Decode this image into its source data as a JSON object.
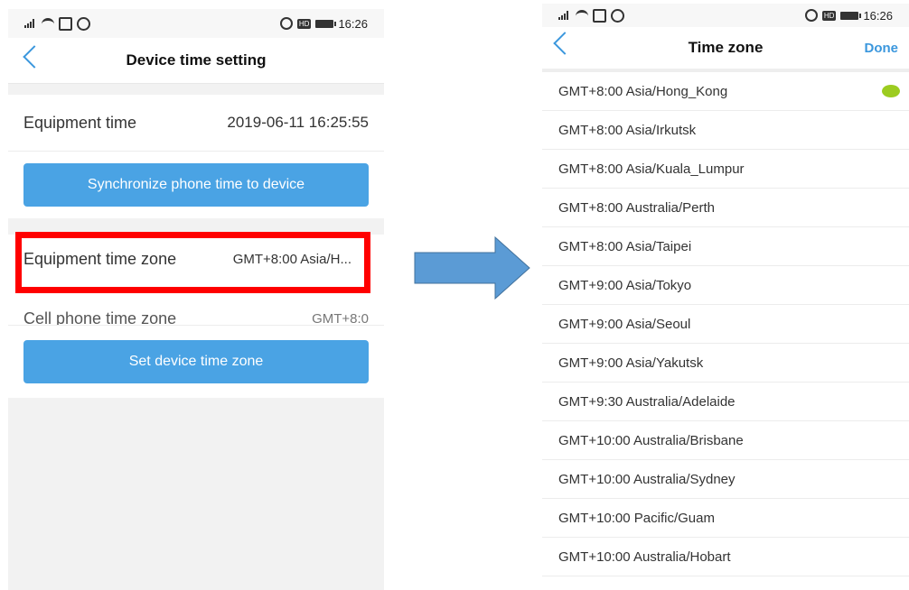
{
  "status": {
    "time": "16:26",
    "network": "4G",
    "hd": "HD"
  },
  "left": {
    "title": "Device time setting",
    "equipment_time_label": "Equipment time",
    "equipment_time_value": "2019-06-11 16:25:55",
    "sync_button": "Synchronize phone time to device",
    "equipment_zone_label": "Equipment time zone",
    "equipment_zone_value": "GMT+8:00 Asia/H...",
    "cell_zone_label": "Cell phone time zone",
    "cell_zone_value": "GMT+8:0",
    "set_button": "Set device time zone"
  },
  "right": {
    "title": "Time zone",
    "done": "Done",
    "zones": [
      "GMT+8:00 Asia/Hong_Kong",
      "GMT+8:00 Asia/Irkutsk",
      "GMT+8:00 Asia/Kuala_Lumpur",
      "GMT+8:00 Australia/Perth",
      "GMT+8:00 Asia/Taipei",
      "GMT+9:00 Asia/Tokyo",
      "GMT+9:00 Asia/Seoul",
      "GMT+9:00 Asia/Yakutsk",
      "GMT+9:30 Australia/Adelaide",
      "GMT+10:00 Australia/Brisbane",
      "GMT+10:00 Australia/Sydney",
      "GMT+10:00 Pacific/Guam",
      "GMT+10:00 Australia/Hobart"
    ],
    "selected_index": 0
  },
  "colors": {
    "accent": "#3b97dd",
    "button": "#4aa3e4",
    "highlight": "#ff0000",
    "selected_dot": "#9ccc20",
    "arrow": "#5b9bd5"
  }
}
